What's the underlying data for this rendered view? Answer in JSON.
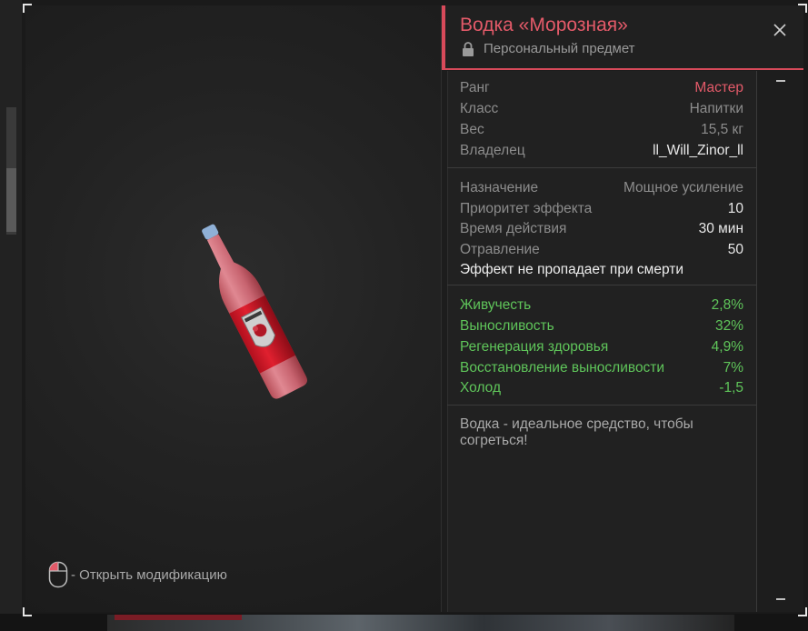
{
  "item": {
    "title": "Водка «Морозная»",
    "subtitle": "Персональный предмет"
  },
  "hint": {
    "text": "- Открыть модификацию"
  },
  "info_rows": [
    {
      "label": "Ранг",
      "value": "Мастер"
    },
    {
      "label": "Класс",
      "value": "Напитки"
    },
    {
      "label": "Вес",
      "value": "15,5 кг"
    },
    {
      "label": "Владелец",
      "value": "ll_Will_Zinor_ll"
    }
  ],
  "effect_rows": [
    {
      "label": "Назначение",
      "value": "Мощное усиление"
    },
    {
      "label": "Приоритет эффекта",
      "value": "10"
    },
    {
      "label": "Время действия",
      "value": "30 мин"
    },
    {
      "label": "Отравление",
      "value": "50"
    }
  ],
  "effect_note": "Эффект не пропадает при смерти",
  "bonus_rows": [
    {
      "label": "Живучесть",
      "value": "2,8%"
    },
    {
      "label": "Выносливость",
      "value": "32%"
    },
    {
      "label": "Регенерация здоровья",
      "value": "4,9%"
    },
    {
      "label": "Восстановление выносливости",
      "value": "7%"
    },
    {
      "label": "Холод",
      "value": "-1,5"
    }
  ],
  "description": "Водка - идеальное средство, чтобы согреться!",
  "colors": {
    "accent": "#e35a69",
    "bonus": "#5fc55a",
    "panel": "#212121"
  },
  "icons": {
    "lock": "lock-icon",
    "close": "close-icon",
    "mouse": "mouse-left-click-icon"
  }
}
